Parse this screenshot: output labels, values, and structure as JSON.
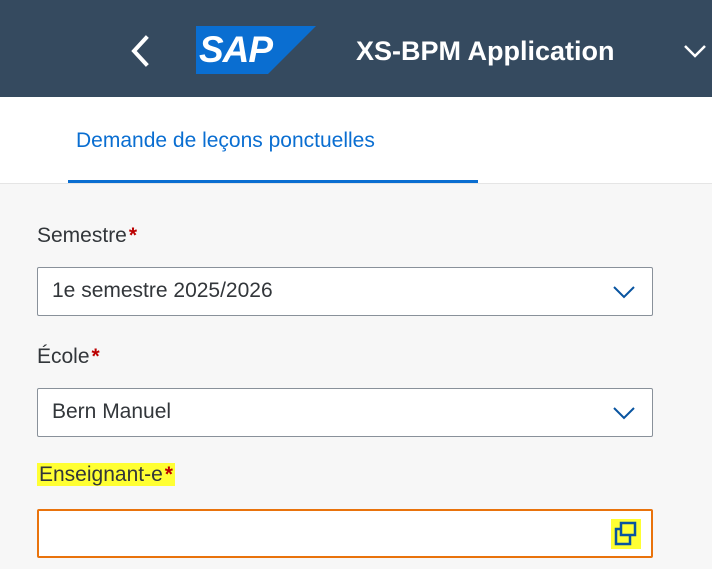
{
  "shell": {
    "app_title": "XS-BPM Application",
    "logo_text": "SAP",
    "back_icon": "back-chevron-icon",
    "title_menu_icon": "chevron-down-icon",
    "colors": {
      "shell_bg": "#354a5f",
      "logo_blue": "#0a6ed1"
    }
  },
  "tabs": [
    {
      "label": "Demande de leçons ponctuelles",
      "selected": true
    }
  ],
  "form": {
    "semestre": {
      "label": "Semestre",
      "required_mark": "*",
      "value": "1e semestre 2025/2026",
      "icon": "chevron-down-icon"
    },
    "ecole": {
      "label": "École",
      "required_mark": "*",
      "value": "Bern Manuel",
      "icon": "chevron-down-icon"
    },
    "enseignant": {
      "label": "Enseignant-e",
      "required_mark": "*",
      "value": "",
      "icon": "value-help-icon",
      "highlight_color": "#ffff33",
      "border_color": "#e9730c"
    }
  }
}
